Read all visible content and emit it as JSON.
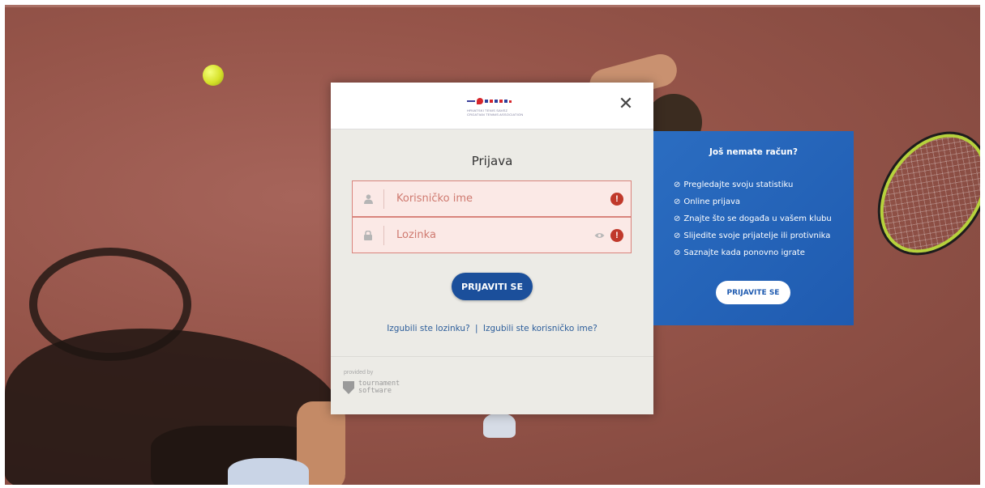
{
  "modal": {
    "logo_text": "HRVATSKI TENIS SAVEZ\nCROATIAN TENNIS ASSOCIATION",
    "close_symbol": "✕",
    "title": "Prijava",
    "username": {
      "placeholder": "Korisničko ime",
      "icon": "user-icon",
      "error_symbol": "!"
    },
    "password": {
      "placeholder": "Lozinka",
      "icon": "lock-icon",
      "reveal_icon": "eye-icon",
      "error_symbol": "!"
    },
    "login_button": "PRIJAVITI SE",
    "forgot_password": "Izgubili ste lozinku?",
    "separator": "|",
    "forgot_username": "Izgubili ste korisničko ime?",
    "provided_by": "provided by",
    "provider_line1": "tournament",
    "provider_line2": "software"
  },
  "side_panel": {
    "title": "Još nemate račun?",
    "benefits": [
      "Pregledajte svoju statistiku",
      "Online prijava",
      "Znajte što se događa u vašem klubu",
      "Slijedite svoje prijatelje ili protivnika",
      "Saznajte kada ponovno igrate"
    ],
    "register_button": "PRIJAVITE SE",
    "check_icon": "⊘"
  },
  "colors": {
    "primary_button": "#1b4f9b",
    "side_panel": "#2160b5",
    "error": "#c0392b",
    "field_error_bg": "#fbe9e6"
  }
}
